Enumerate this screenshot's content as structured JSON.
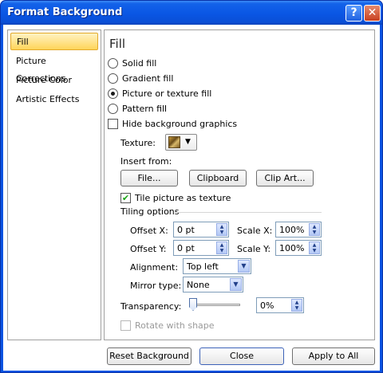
{
  "window": {
    "title": "Format Background",
    "help_glyph": "?",
    "close_glyph": "✕"
  },
  "nav": {
    "items": [
      {
        "label": "Fill",
        "selected": true
      },
      {
        "label": "Picture Corrections"
      },
      {
        "label": "Picture Color"
      },
      {
        "label": "Artistic Effects"
      }
    ]
  },
  "fill": {
    "heading": "Fill",
    "options": [
      {
        "label": "Solid fill",
        "checked": false
      },
      {
        "label": "Gradient fill",
        "checked": false
      },
      {
        "label": "Picture or texture fill",
        "checked": true
      },
      {
        "label": "Pattern fill",
        "checked": false
      }
    ],
    "hide_background_label": "Hide background graphics",
    "hide_background_checked": false,
    "texture_label": "Texture:",
    "texture_icon": "texture-swatch-icon",
    "insert_from_label": "Insert from:",
    "buttons": {
      "file": "File...",
      "clipboard": "Clipboard",
      "clip_art": "Clip Art..."
    },
    "tile_label": "Tile picture as texture",
    "tile_checked": true,
    "check_glyph": "✔",
    "tiling_options_label": "Tiling options",
    "offset_x_label": "Offset X:",
    "offset_x_value": "0 pt",
    "scale_x_label": "Scale X:",
    "scale_x_value": "100%",
    "offset_y_label": "Offset Y:",
    "offset_y_value": "0 pt",
    "scale_y_label": "Scale Y:",
    "scale_y_value": "100%",
    "alignment_label": "Alignment:",
    "alignment_value": "Top left",
    "mirror_label": "Mirror type:",
    "mirror_value": "None",
    "transparency_label": "Transparency:",
    "transparency_value": "0%",
    "transparency_level": 0,
    "rotate_label": "Rotate with shape",
    "rotate_checked": false,
    "rotate_disabled": true
  },
  "footer": {
    "reset_label": "Reset Background",
    "close_label": "Close",
    "apply_all_label": "Apply to All"
  }
}
